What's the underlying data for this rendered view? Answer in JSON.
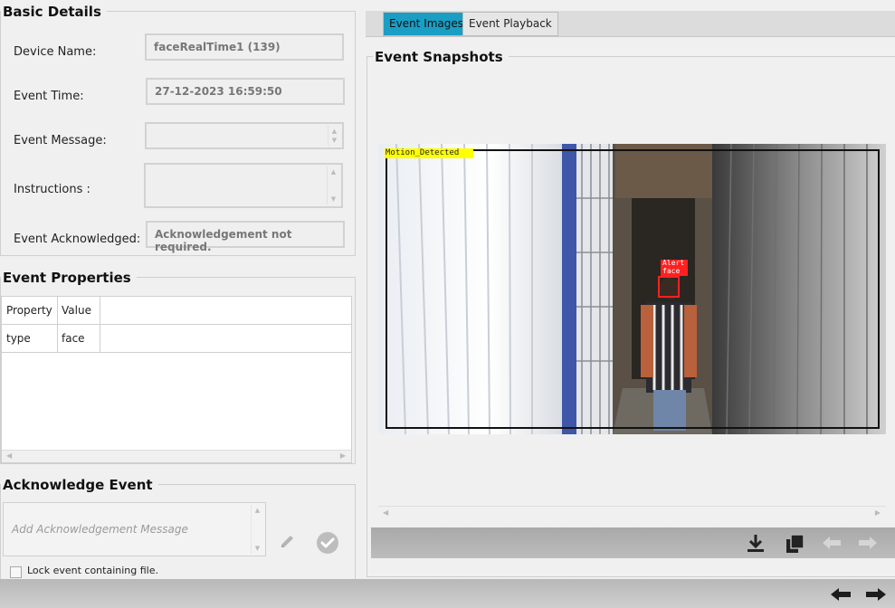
{
  "basic_details": {
    "title": "Basic Details",
    "device_name_label": "Device Name:",
    "device_name_value": "faceRealTime1 (139)",
    "event_time_label": "Event Time:",
    "event_time_value": "27-12-2023 16:59:50",
    "event_message_label": "Event Message:",
    "event_message_value": "",
    "instructions_label": "Instructions :",
    "instructions_value": "",
    "event_ack_label": "Event Acknowledged:",
    "event_ack_value": "Acknowledgement not required."
  },
  "event_properties": {
    "title": "Event Properties",
    "columns": [
      "Property",
      "Value"
    ],
    "rows": [
      {
        "property": "type",
        "value": "face"
      }
    ]
  },
  "acknowledge": {
    "title": "Acknowledge Event",
    "placeholder": "Add Acknowledgement Message",
    "lock_label": "Lock event containing file."
  },
  "tabs": {
    "event_images": "Event Images",
    "event_playback": "Event Playback"
  },
  "snapshots": {
    "title": "Event Snapshots",
    "overlay_motion": "Motion_Detected",
    "overlay_alert": "Alert",
    "overlay_face": "face"
  },
  "icons": {
    "download": "download-icon",
    "copy": "copy-icon",
    "prev_image": "arrow-left-icon",
    "next_image": "arrow-right-icon",
    "edit": "pencil-icon",
    "confirm": "check-circle-icon",
    "prev_event": "arrow-left-icon",
    "next_event": "arrow-right-icon"
  },
  "colors": {
    "active_tab": "#1a9ec4",
    "motion_label_bg": "#ffff00",
    "alert_box": "#ff2020"
  }
}
